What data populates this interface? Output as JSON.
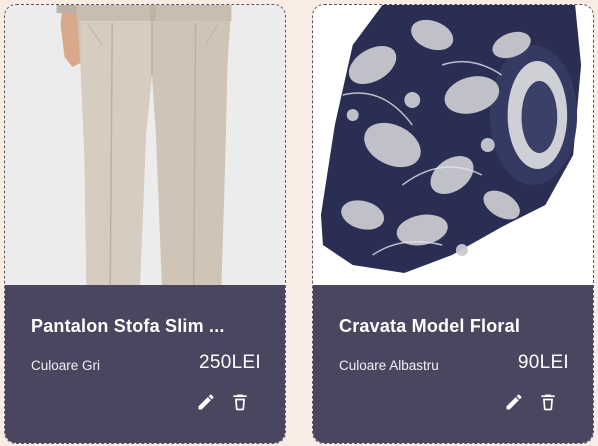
{
  "products": [
    {
      "title": "Pantalon Stofa Slim ...",
      "color_label": "Culoare Gri",
      "price": "250LEI",
      "image_icon": "beige-trousers-photo",
      "actions": [
        "edit-icon",
        "delete-icon"
      ]
    },
    {
      "title": "Cravata Model Floral",
      "color_label": "Culoare Albastru",
      "price": "90LEI",
      "image_icon": "floral-navy-tie-photo",
      "actions": [
        "edit-icon",
        "delete-icon"
      ]
    }
  ],
  "colors": {
    "page_background": "#f9ece4",
    "card_info_background": "#4a4660",
    "text": "#ffffff"
  }
}
